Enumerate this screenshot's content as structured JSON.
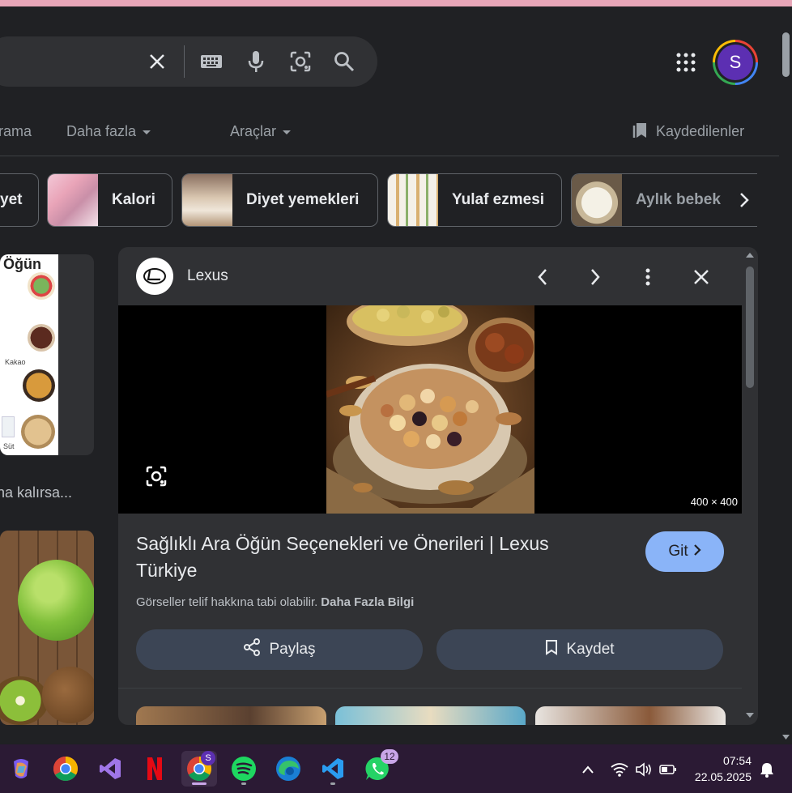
{
  "search": {
    "icons": [
      "close-icon",
      "keyboard-icon",
      "mic-icon",
      "lens-icon",
      "search-icon"
    ]
  },
  "account": {
    "initial": "S"
  },
  "nav": {
    "tabs": [
      {
        "label": "Arama"
      },
      {
        "label": "Daha fazla"
      },
      {
        "label": "Araçlar"
      }
    ],
    "saved_label": "Kaydedilenler"
  },
  "chips": [
    {
      "label": "yet"
    },
    {
      "label": "Kalori"
    },
    {
      "label": "Diyet yemekleri"
    },
    {
      "label": "Yulaf ezmesi"
    },
    {
      "label": "Aylık bebek"
    }
  ],
  "left_results": {
    "image1_text": "Öğün",
    "image1_label": "Kakao",
    "image1_label2": "Süt",
    "caption": "na kalırsa..."
  },
  "preview": {
    "source": "Lexus",
    "dimensions": "400 × 400",
    "title": "Sağlıklı Ara Öğün Seçenekleri ve Önerileri | Lexus Türkiye",
    "visit_label": "Git",
    "copyright_text": "Görseller telif hakkına tabi olabilir.",
    "copyright_link": "Daha Fazla Bilgi",
    "share_label": "Paylaş",
    "save_label": "Kaydet"
  },
  "taskbar": {
    "apps": [
      "copilot",
      "chrome",
      "visual-studio",
      "netflix",
      "chrome-profile",
      "spotify",
      "edge",
      "vscode",
      "whatsapp"
    ],
    "whatsapp_badge": "12",
    "chrome_profile_initial": "S",
    "time": "07:54",
    "date": "22.05.2025"
  },
  "colors": {
    "background": "#202124",
    "accent": "#8ab4f8",
    "taskbar": "#2b1a34"
  }
}
